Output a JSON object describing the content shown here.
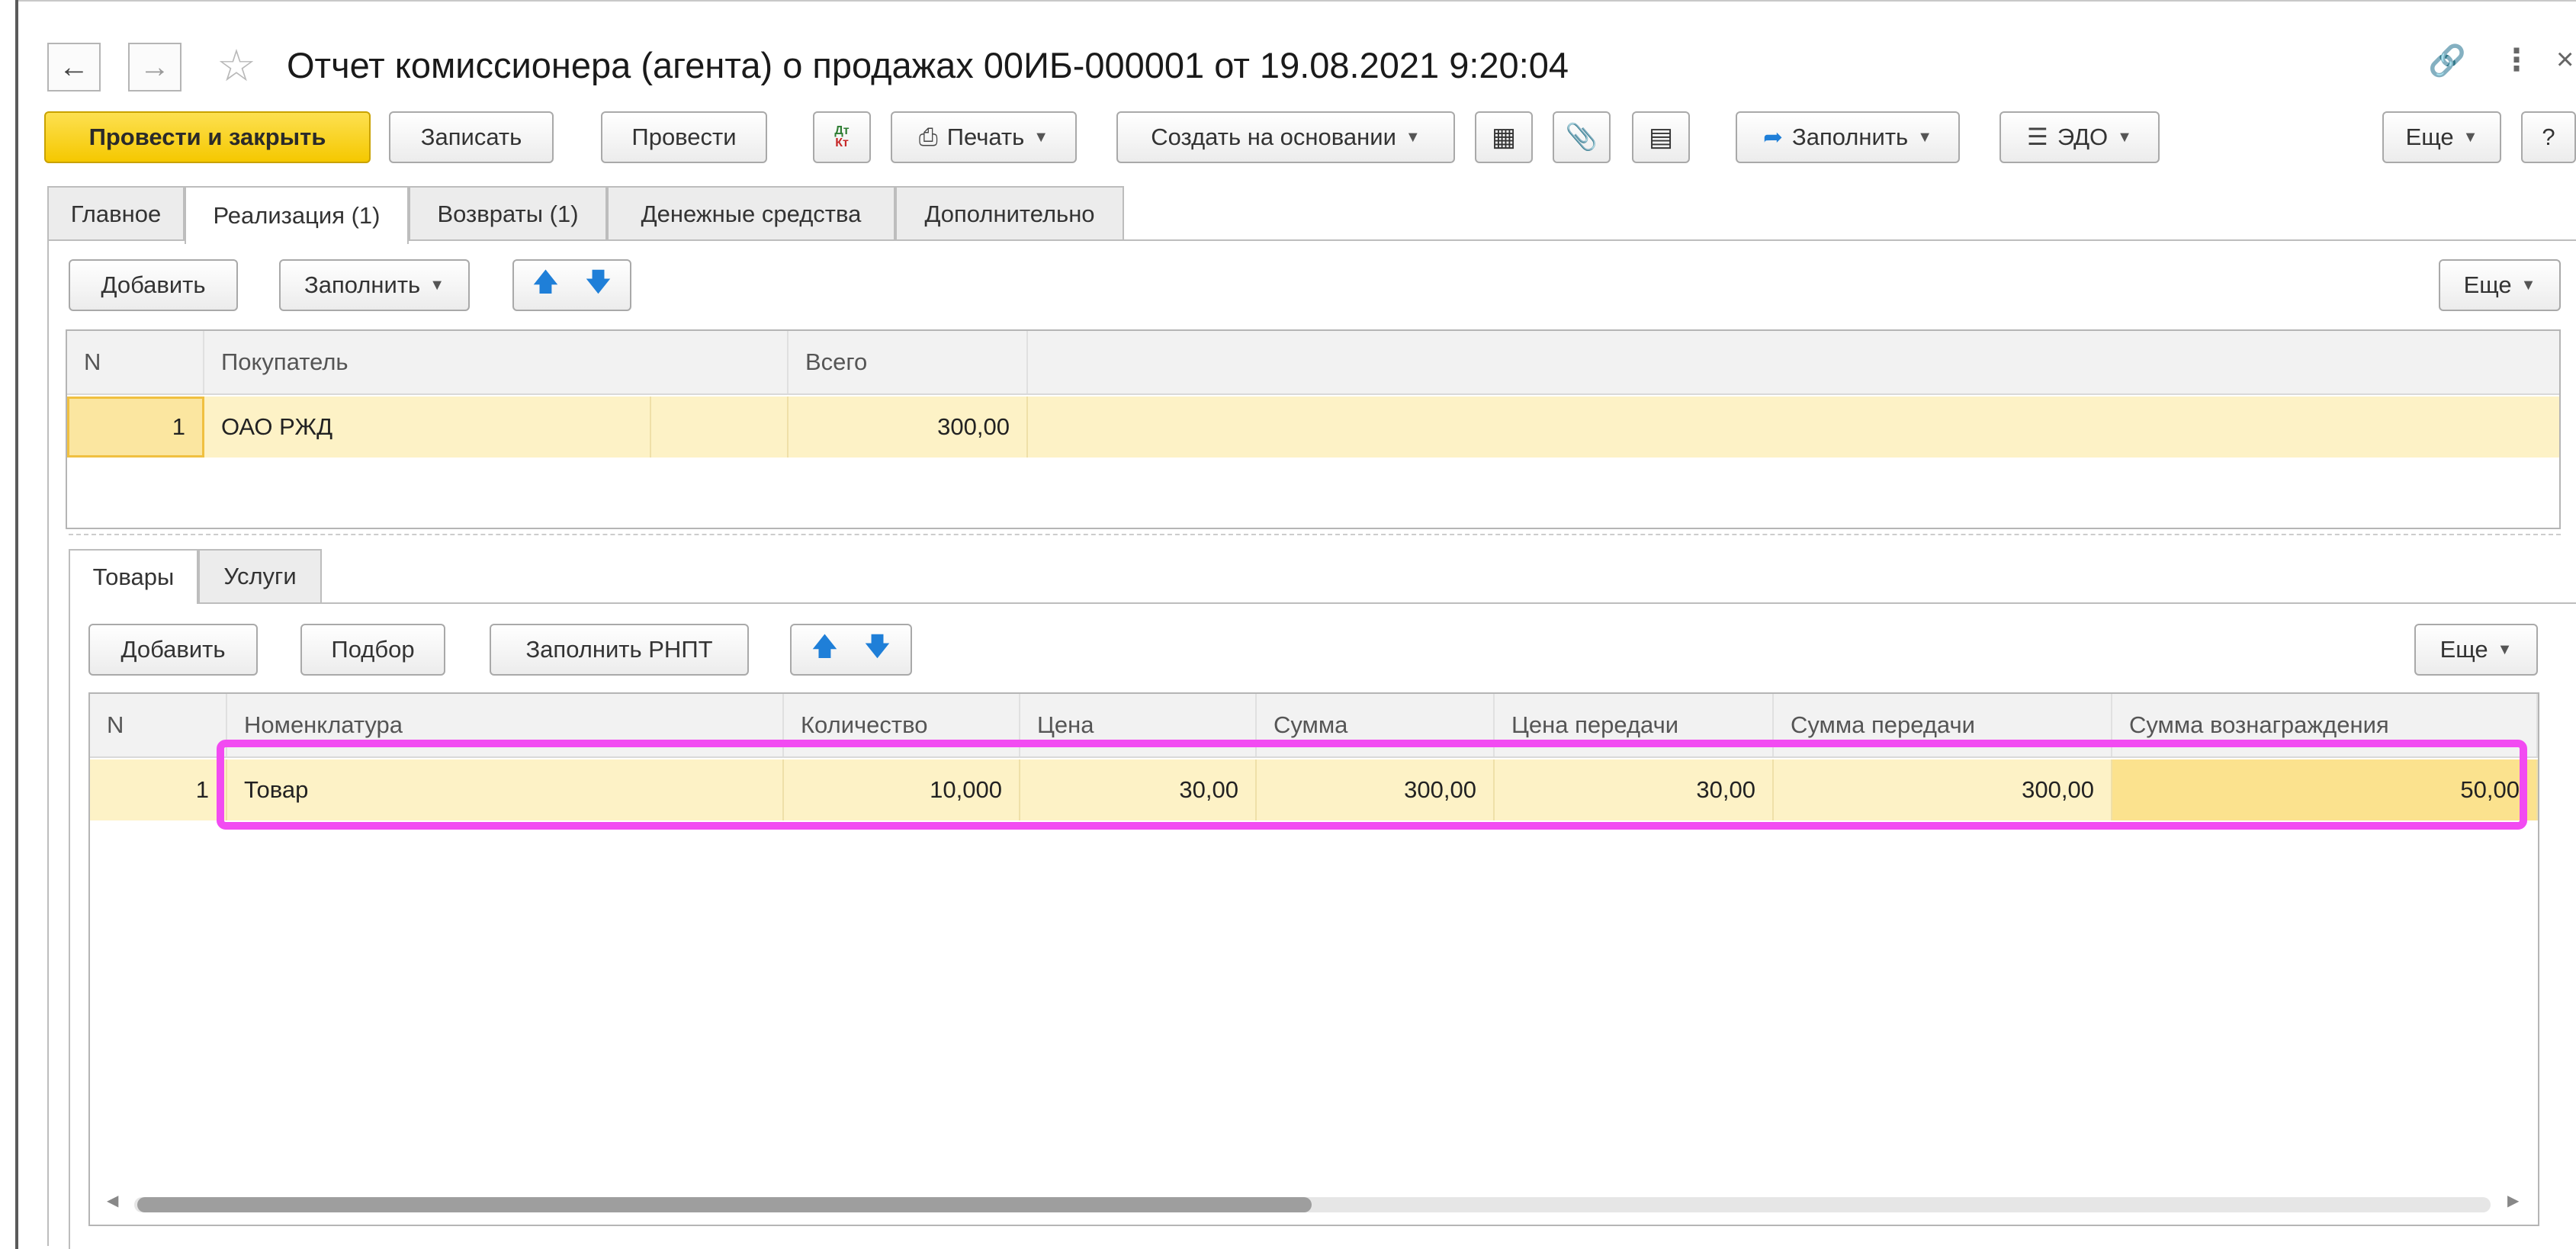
{
  "window": {
    "title": "Отчет комиссионера (агента) о продажах 00ИБ-000001 от 19.08.2021 9:20:04",
    "back_icon": "arrow-left-icon",
    "forward_icon": "arrow-right-icon",
    "star_icon": "star-icon",
    "link_icon": "link-icon",
    "menu_icon": "more-vertical-icon",
    "close_icon": "close-icon"
  },
  "toolbar": {
    "post_close": "Провести и закрыть",
    "save": "Записать",
    "post": "Провести",
    "dtkt_top": "Дт",
    "dtkt_bottom": "Кт",
    "print": "Печать",
    "create_based": "Создать на основании",
    "fill": "Заполнить",
    "edo": "ЭДО",
    "more": "Еще",
    "help": "?"
  },
  "tabs": [
    "Главное",
    "Реализация (1)",
    "Возвраты (1)",
    "Денежные средства",
    "Дополнительно"
  ],
  "buyers": {
    "add": "Добавить",
    "fill": "Заполнить",
    "more": "Еще",
    "columns": [
      "N",
      "Покупатель",
      "Всего"
    ],
    "rows": [
      {
        "n": "1",
        "buyer": "ОАО РЖД",
        "total": "300,00"
      }
    ]
  },
  "subtabs": [
    "Товары",
    "Услуги"
  ],
  "goods": {
    "add": "Добавить",
    "select": "Подбор",
    "fill_rnpt": "Заполнить РНПТ",
    "more": "Еще",
    "columns": [
      "N",
      "Номенклатура",
      "Количество",
      "Цена",
      "Сумма",
      "Цена передачи",
      "Сумма передачи",
      "Сумма вознаграждения"
    ],
    "rows": [
      {
        "n": "1",
        "item": "Товар",
        "qty": "10,000",
        "price": "30,00",
        "sum": "300,00",
        "transfer_price": "30,00",
        "transfer_sum": "300,00",
        "reward_sum": "50,00"
      }
    ]
  },
  "colors": {
    "primary_button": "#f5c800",
    "selected_row": "#fdf2c6",
    "highlight": "#f24bf2",
    "up_arrow": "#1f7fd8"
  }
}
